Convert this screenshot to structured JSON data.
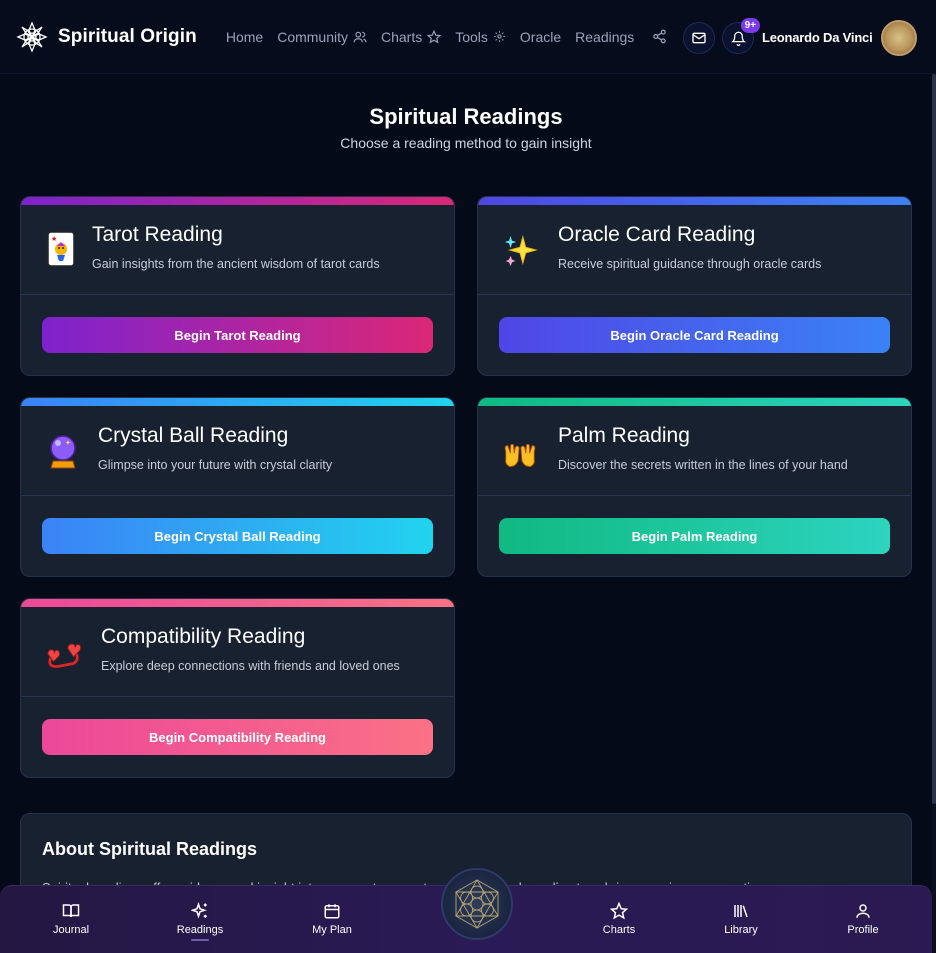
{
  "app": {
    "brand_name": "Spiritual Origin",
    "nav": [
      {
        "label": "Home"
      },
      {
        "label": "Community"
      },
      {
        "label": "Charts"
      },
      {
        "label": "Tools"
      },
      {
        "label": "Oracle"
      },
      {
        "label": "Readings"
      }
    ],
    "notification_badge": "9+",
    "user_name": "Leonardo Da Vinci"
  },
  "header": {
    "title": "Spiritual Readings",
    "subtitle": "Choose a reading method to gain insight"
  },
  "cards": [
    {
      "title": "Tarot Reading",
      "desc": "Gain insights from the ancient wisdom of tarot cards",
      "button": "Begin Tarot Reading",
      "icon": "tarot-card-icon",
      "colors": [
        "#7e22ce",
        "#db2777"
      ]
    },
    {
      "title": "Oracle Card Reading",
      "desc": "Receive spiritual guidance through oracle cards",
      "button": "Begin Oracle Card Reading",
      "icon": "sparkles-icon",
      "colors": [
        "#4f46e5",
        "#3b82f6"
      ]
    },
    {
      "title": "Crystal Ball Reading",
      "desc": "Glimpse into your future with crystal clarity",
      "button": "Begin Crystal Ball Reading",
      "icon": "crystal-ball-icon",
      "colors": [
        "#3b82f6",
        "#22d3ee"
      ]
    },
    {
      "title": "Palm Reading",
      "desc": "Discover the secrets written in the lines of your hand",
      "button": "Begin Palm Reading",
      "icon": "open-hands-icon",
      "colors": [
        "#10b981",
        "#2dd4bf"
      ]
    },
    {
      "title": "Compatibility Reading",
      "desc": "Explore deep connections with friends and loved ones",
      "button": "Begin Compatibility Reading",
      "icon": "revolving-hearts-icon",
      "colors": [
        "#ec4899",
        "#fb7185"
      ]
    }
  ],
  "about": {
    "title": "About Spiritual Readings",
    "text": "Spiritual readings offer guidance and insight into your past, present and future. Each reading type brings a unique perspective."
  },
  "bottom_nav": [
    {
      "label": "Journal",
      "icon": "book-icon"
    },
    {
      "label": "Readings",
      "icon": "sparkles-icon"
    },
    {
      "label": "My Plan",
      "icon": "calendar-icon"
    },
    {
      "label": "Charts",
      "icon": "star-icon"
    },
    {
      "label": "Library",
      "icon": "library-icon"
    },
    {
      "label": "Profile",
      "icon": "user-icon"
    }
  ]
}
